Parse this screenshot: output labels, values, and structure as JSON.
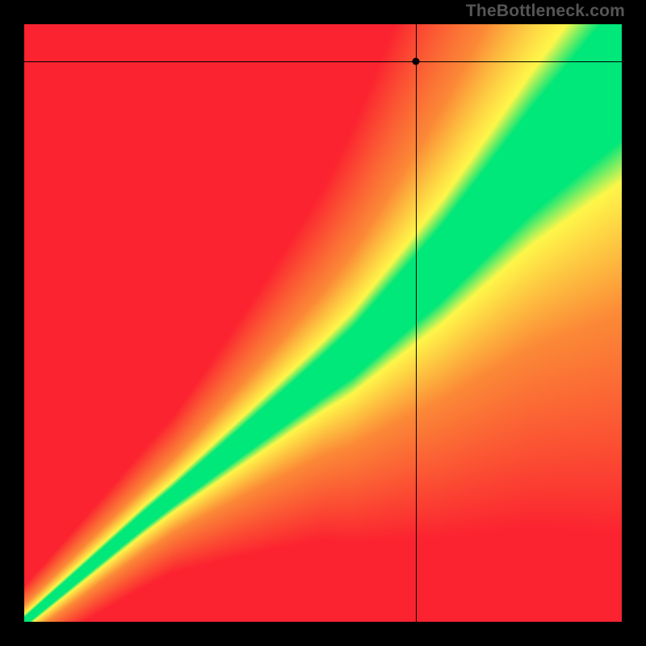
{
  "watermark": "TheBottleneck.com",
  "colors": {
    "background": "#000000",
    "gradient_corners": {
      "bottom_left": "#fb2330",
      "top_left": "#fb2330",
      "bottom_right": "#fb2330",
      "top_right": "#fff74a"
    },
    "optimal_band": "#00e77a",
    "transition": "#fff74a",
    "crosshair": "#000000",
    "marker": "#000000"
  },
  "crosshair": {
    "x_frac": 0.655,
    "y_frac": 0.062
  },
  "chart_data": {
    "type": "heatmap",
    "title": "",
    "xlabel": "",
    "ylabel": "",
    "xlim": [
      0,
      100
    ],
    "ylim": [
      0,
      100
    ],
    "description": "Square heatmap showing bottleneck severity. A green diagonal band (optimal balance) runs from bottom-left toward top-right, widening significantly in the upper-right half. Surrounding the band is a yellow transition zone that fades into orange then red in the corners furthest from the band. A crosshair marks a point near the top of the chart, about 65% across, well above the green band in the yellow/orange region.",
    "marker_point": {
      "x": 65.5,
      "y": 93.8
    },
    "optimal_band": {
      "center_line": [
        {
          "x": 0,
          "y": 0
        },
        {
          "x": 20,
          "y": 17
        },
        {
          "x": 40,
          "y": 33
        },
        {
          "x": 55,
          "y": 45
        },
        {
          "x": 70,
          "y": 60
        },
        {
          "x": 85,
          "y": 77
        },
        {
          "x": 100,
          "y": 92
        }
      ],
      "half_width_at": [
        {
          "x": 0,
          "w": 1.0
        },
        {
          "x": 25,
          "w": 2.0
        },
        {
          "x": 50,
          "w": 4.0
        },
        {
          "x": 75,
          "w": 7.0
        },
        {
          "x": 100,
          "w": 10.0
        }
      ]
    },
    "legend": null
  }
}
